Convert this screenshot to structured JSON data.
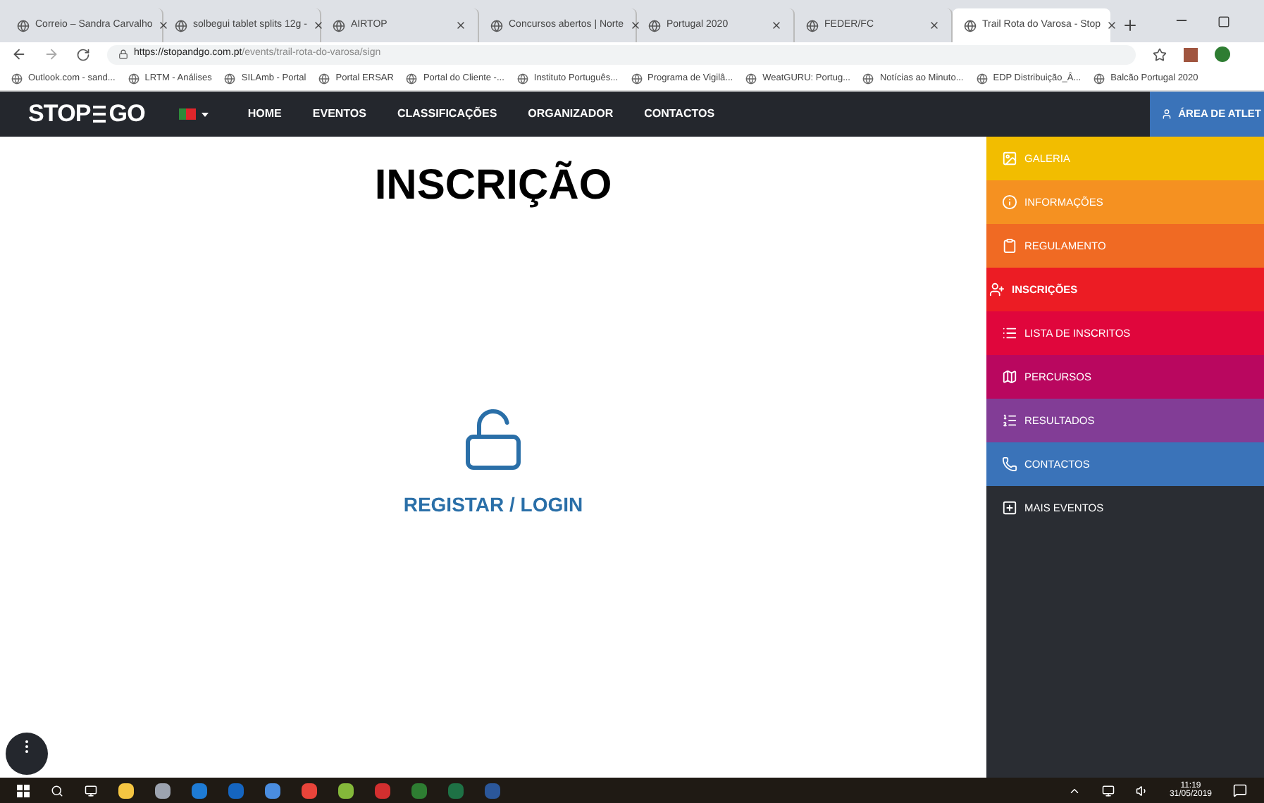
{
  "browser": {
    "tabs": [
      {
        "title": "Correio – Sandra Carvalho",
        "selected": false
      },
      {
        "title": "solbegui tablet splits 12g -",
        "selected": false
      },
      {
        "title": "AIRTOP",
        "selected": false
      },
      {
        "title": "Concursos abertos | Norte",
        "selected": false
      },
      {
        "title": "Portugal 2020",
        "selected": false
      },
      {
        "title": "FEDER/FC",
        "selected": false
      },
      {
        "title": "Trail Rota do Varosa - Stop",
        "selected": true
      }
    ],
    "url_host": "https://stopandgo.com.pt",
    "url_path": "/events/trail-rota-do-varosa/sign",
    "bookmarks": [
      "Outlook.com - sand...",
      "LRTM - Análises",
      "SILAmb - Portal",
      "Portal ERSAR",
      "Portal do Cliente -...",
      "Instituto Português...",
      "Programa de Vigilâ...",
      "WeatGURU: Portug...",
      "Notícias ao Minuto...",
      "EDP Distribuição_Â...",
      "Balcão Portugal 2020"
    ]
  },
  "navbar": {
    "logo_left": "STOP",
    "logo_right": "GO",
    "links": [
      "HOME",
      "EVENTOS",
      "CLASSIFICAÇÕES",
      "ORGANIZADOR",
      "CONTACTOS"
    ],
    "account": "ÁREA DE ATLET"
  },
  "main": {
    "title": "INSCRIÇÃO",
    "action": "REGISTAR / LOGIN"
  },
  "sidebar": [
    {
      "label": "GALERIA",
      "color": "#f2bd00",
      "selected": false
    },
    {
      "label": "INFORMAÇÕES",
      "color": "#f59121",
      "selected": false
    },
    {
      "label": "REGULAMENTO",
      "color": "#f06a23",
      "selected": false
    },
    {
      "label": "INSCRIÇÕES",
      "color": "#ec1c24",
      "selected": true
    },
    {
      "label": "LISTA DE INSCRITOS",
      "color": "#e0063c",
      "selected": false
    },
    {
      "label": "PERCURSOS",
      "color": "#b9075f",
      "selected": false
    },
    {
      "label": "RESULTADOS",
      "color": "#823d96",
      "selected": false
    },
    {
      "label": "CONTACTOS",
      "color": "#3a73b9",
      "selected": false
    },
    {
      "label": "MAIS EVENTOS",
      "color": "#2a2d33",
      "selected": false
    }
  ],
  "taskbar": {
    "time": "11:19",
    "date": "31/05/2019"
  }
}
